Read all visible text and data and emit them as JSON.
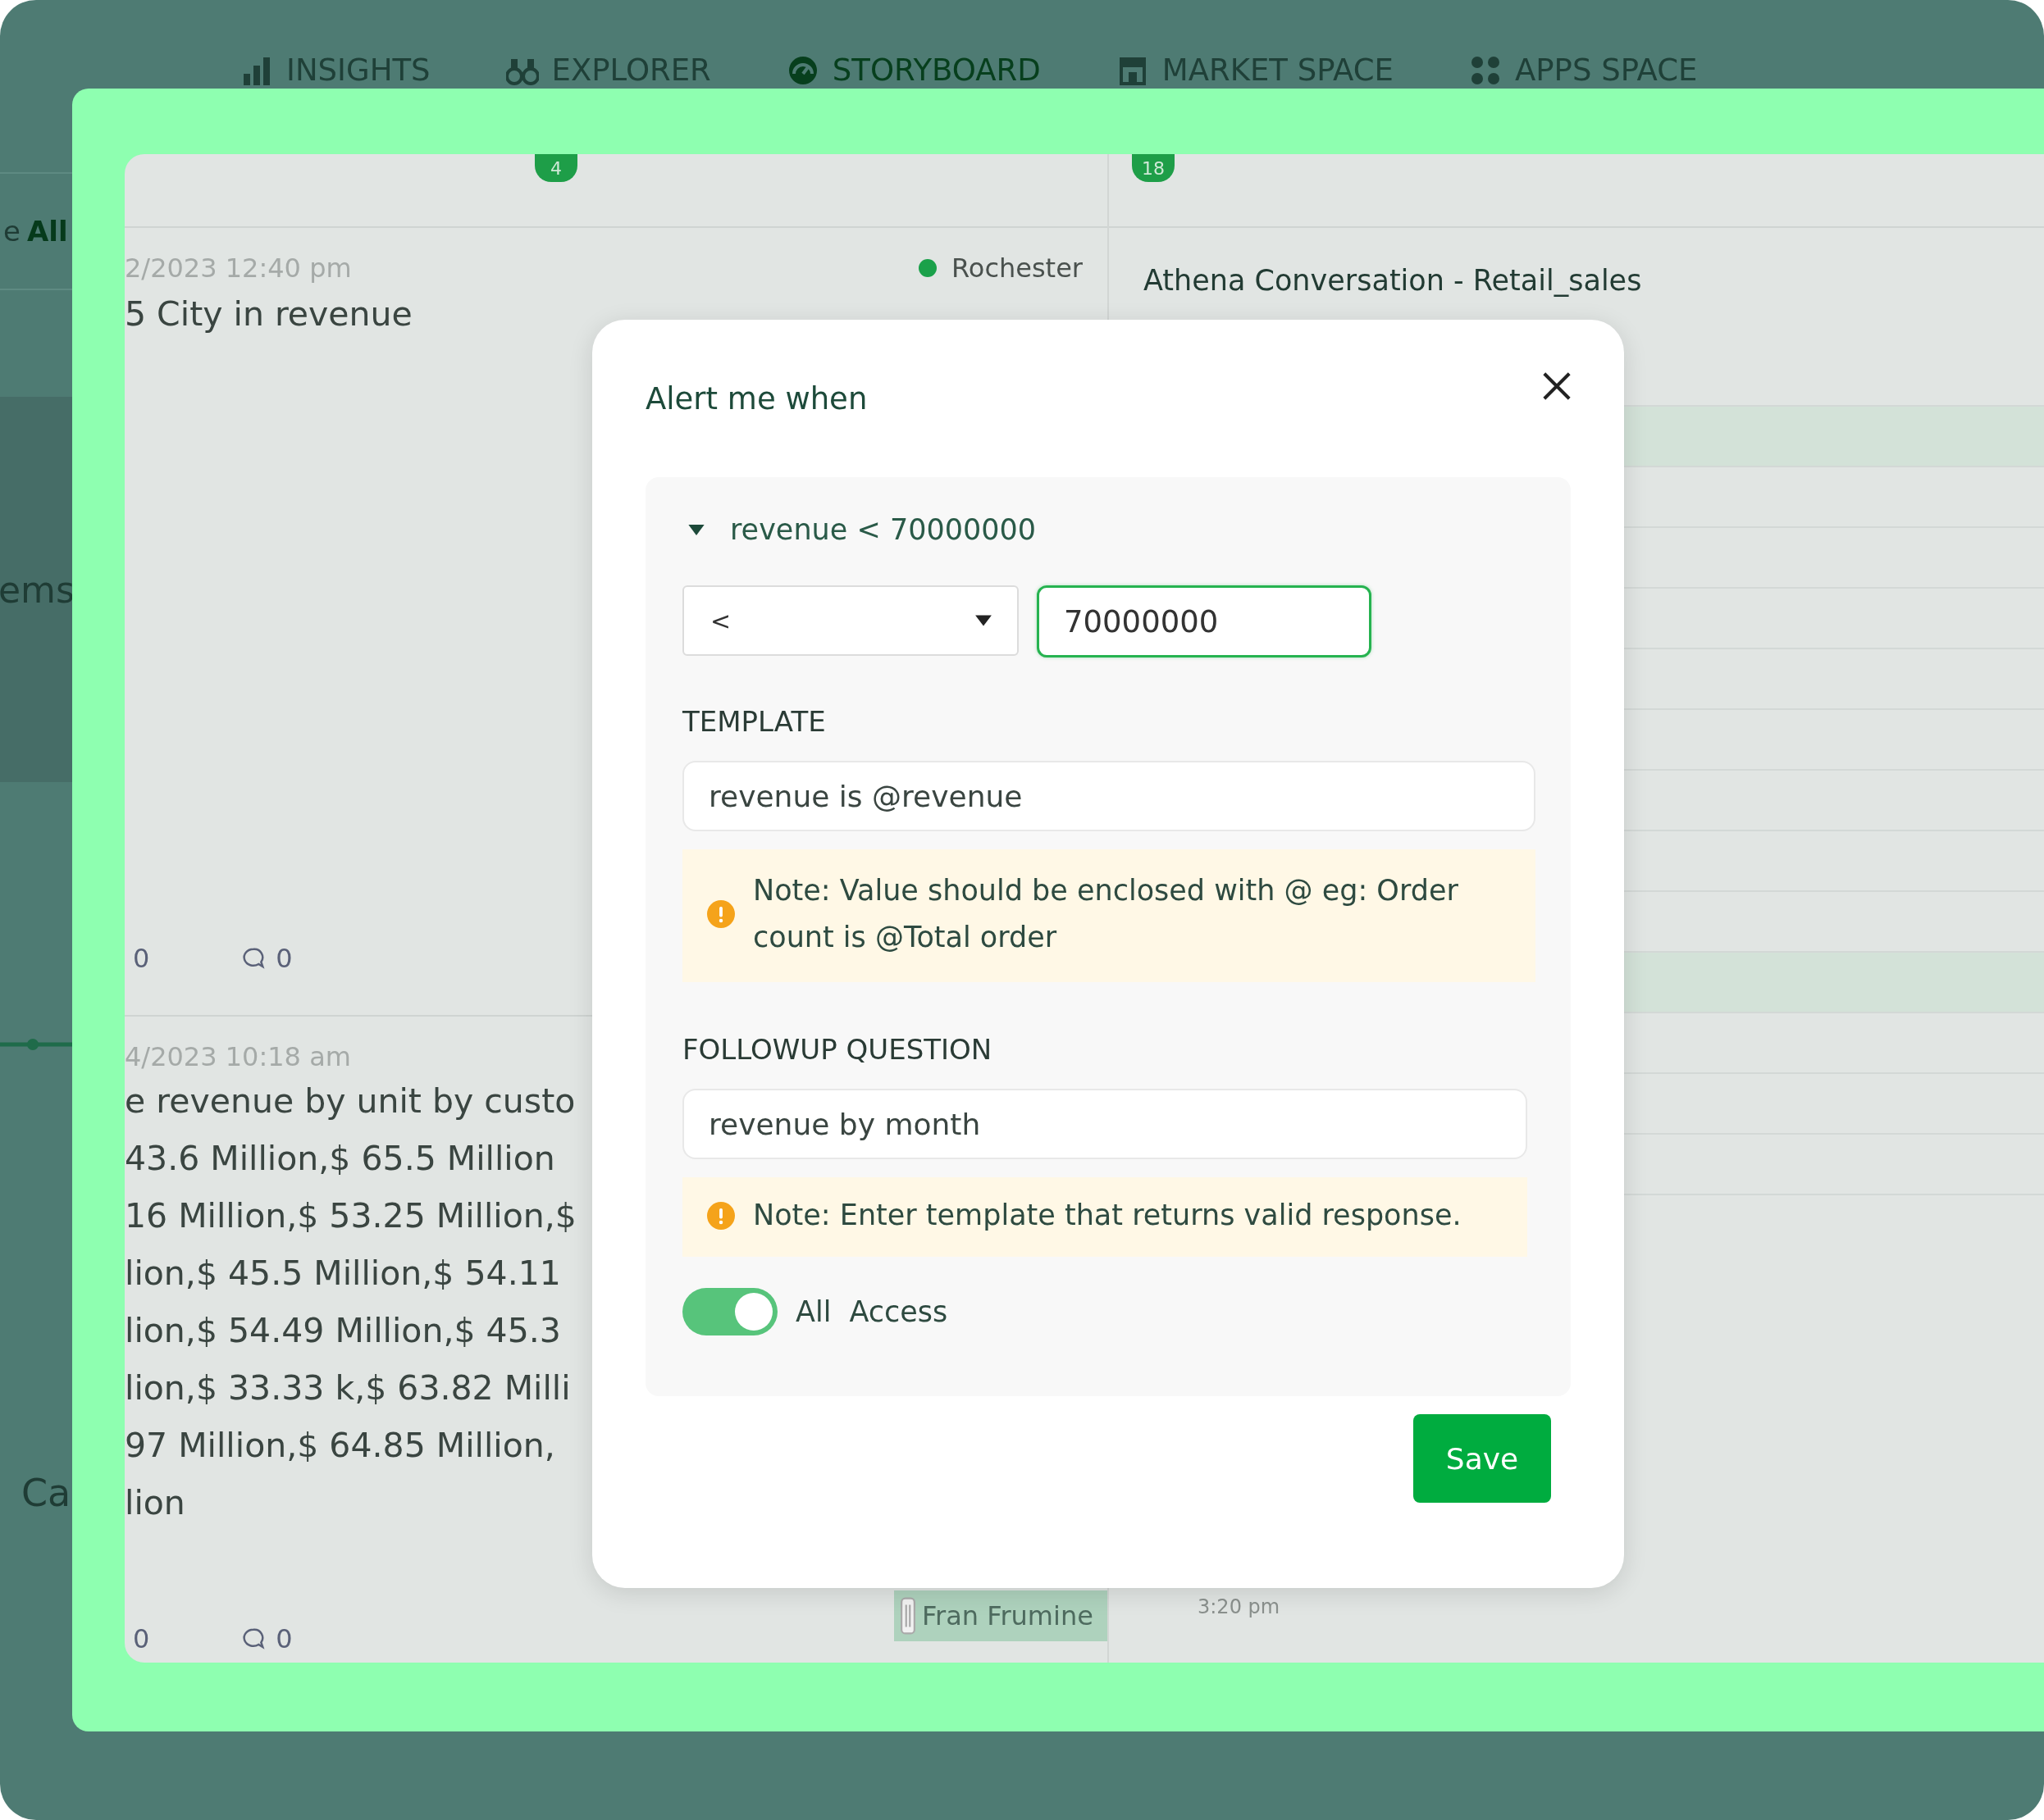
{
  "nav": {
    "tabs": [
      {
        "label": "INSIGHTS",
        "selected": false
      },
      {
        "label": "EXPLORER",
        "selected": false
      },
      {
        "label": "STORYBOARD",
        "selected": true
      },
      {
        "label": "MARKET SPACE",
        "selected": false
      },
      {
        "label": "APPS SPACE",
        "selected": false
      }
    ]
  },
  "sidebar": {
    "filter_label": "e",
    "filter_value": "All",
    "item": "ems",
    "bottom_item": "Ca"
  },
  "panel": {
    "badges": [
      "4",
      "18"
    ],
    "feed": [
      {
        "time": "2/2023 12:40 pm",
        "lines": [
          "5 City in revenue"
        ],
        "location": "Rochester",
        "likes": "0",
        "comments": "0"
      },
      {
        "time": "4/2023 10:18 am",
        "lines": [
          "e revenue by unit by custo",
          "43.6 Million,$ 65.5 Million",
          "16 Million,$ 53.25 Million,$",
          "lion,$ 45.5 Million,$ 54.11",
          "lion,$ 54.49 Million,$ 45.3",
          "lion,$ 33.33 k,$ 63.82 Milli",
          "97 Million,$ 64.85 Million,",
          "lion"
        ],
        "likes": "0",
        "comments": "0"
      }
    ],
    "tag": "Fran Frumine",
    "conversation": {
      "title": "Athena Conversation - Retail_sales",
      "time": "3:20 pm"
    }
  },
  "dialog": {
    "title": "Alert me when",
    "condition": {
      "summary": "revenue < 70000000",
      "expanded": true,
      "operator": "<",
      "value": "70000000"
    },
    "template": {
      "label": "TEMPLATE",
      "value": "revenue is @revenue",
      "note": "Note: Value should be enclosed with @ eg: Order count is @Total order"
    },
    "followup": {
      "label": "FOLLOWUP QUESTION",
      "value": "revenue by month",
      "note": "Note: Enter template that returns valid response."
    },
    "access_toggle": {
      "on": true,
      "label_1": "All",
      "label_2": "Access"
    },
    "save": "Save"
  }
}
